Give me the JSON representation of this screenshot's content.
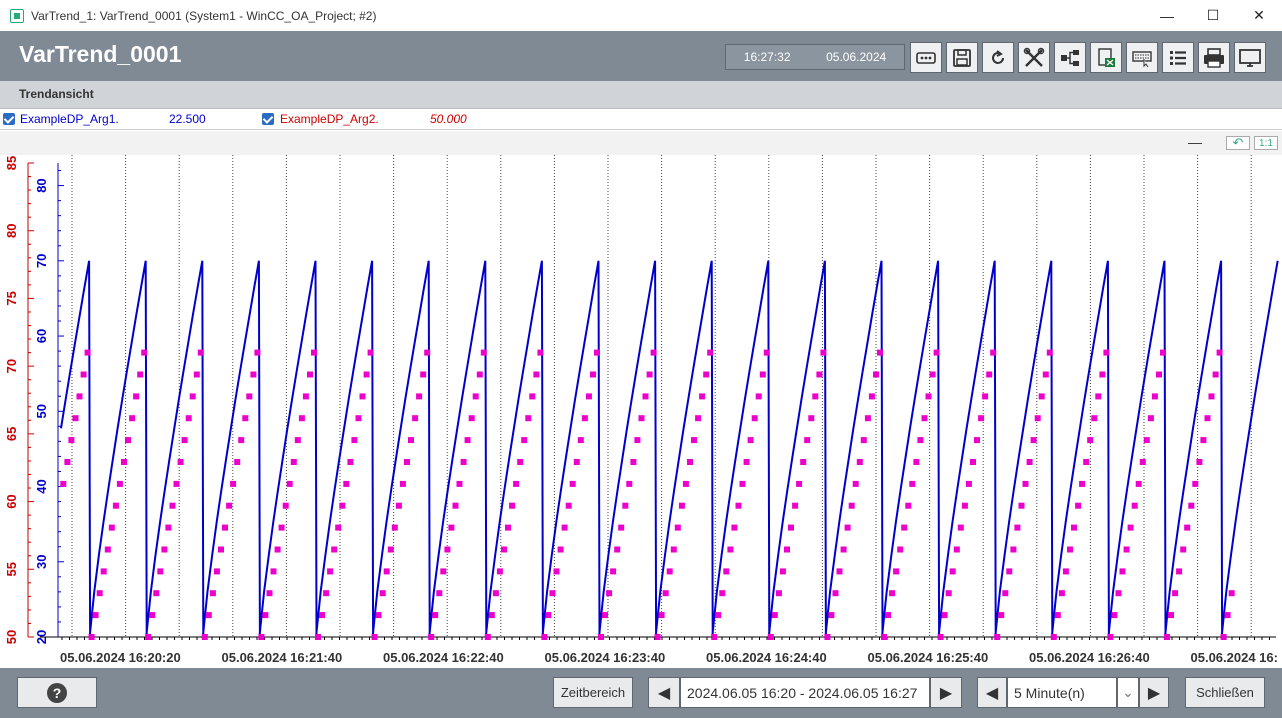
{
  "window": {
    "title": "VarTrend_1: VarTrend_0001 (System1 - WinCC_OA_Project; #2)",
    "minimize_glyph": "—",
    "maximize_glyph": "☐",
    "close_glyph": "✕"
  },
  "header": {
    "title": "VarTrend_0001",
    "time": "16:27:32",
    "date": "05.06.2024",
    "toolbar_icons": [
      "dots-icon",
      "save-icon",
      "refresh-icon",
      "tools-icon",
      "tree-icon",
      "excel-export-icon",
      "keyboard-icon",
      "list-icon",
      "printer-icon",
      "monitor-icon"
    ]
  },
  "subheader": {
    "label": "Trendansicht"
  },
  "legend": {
    "curves": [
      {
        "name": "ExampleDP_Arg1.",
        "value": "22.500",
        "color": "#0000cc"
      },
      {
        "name": "ExampleDP_Arg2.",
        "value": "50.000",
        "color": "#cc0000"
      }
    ]
  },
  "chart_controls": {
    "reset_label": "↶",
    "ratio_label": "1:1",
    "dash_label": "—"
  },
  "chart_data": {
    "type": "line",
    "x_labels": [
      "05.06.2024 16:20:20",
      "05.06.2024 16:21:40",
      "05.06.2024 16:22:40",
      "05.06.2024 16:23:40",
      "05.06.2024 16:24:40",
      "05.06.2024 16:25:40",
      "05.06.2024 16:26:40",
      "05.06.2024 16:"
    ],
    "y_axes": [
      {
        "side": "left-outer",
        "color": "#cc0000",
        "ticks": [
          "50",
          "55",
          "60",
          "65",
          "70",
          "75",
          "80",
          "85"
        ],
        "range": [
          50,
          85
        ]
      },
      {
        "side": "left-inner",
        "color": "#0000cc",
        "ticks": [
          "20",
          "30",
          "40",
          "50",
          "60",
          "70",
          "80"
        ],
        "range": [
          20,
          83
        ]
      }
    ],
    "series": [
      {
        "name": "ExampleDP_Arg1.",
        "color": "#0000cc",
        "style": "line",
        "cycles": 21,
        "min": 20,
        "max": 70
      },
      {
        "name": "ExampleDP_Arg2.",
        "color": "#ee00cc",
        "style": "square-markers",
        "cycles": 21,
        "min": 50,
        "max": 71
      }
    ]
  },
  "footer": {
    "help_label": "?",
    "zeitbereich_label": "Zeitbereich",
    "range_value": "2024.06.05 16:20 - 2024.06.05 16:27",
    "interval_value": "5 Minute(n)",
    "close_label": "Schließen",
    "prev_glyph": "◀",
    "next_glyph": "▶",
    "dropdown_glyph": "⌄"
  }
}
